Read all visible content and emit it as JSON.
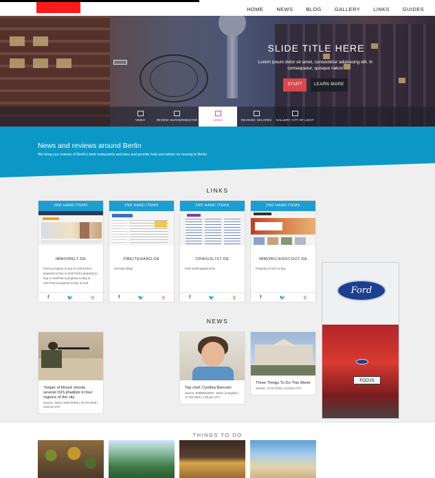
{
  "nav": {
    "items": [
      "HOME",
      "NEWS",
      "BLOG",
      "GALLERY",
      "LINKS",
      "GUIDES"
    ]
  },
  "slider": {
    "title": "SLIDE TITLE HERE",
    "subtitle": "Lorem ipsum dolor sit amet, consectetur adipisicing elit. In consequatur, quisque natus!",
    "start_label": "START",
    "more_label": "LEARN MORE",
    "tabs": [
      {
        "label": "VIDEO",
        "icon": "image-icon",
        "active": false
      },
      {
        "label": "REVIEW: BURGERMEISTER",
        "icon": "checkbox-icon",
        "active": false
      },
      {
        "label": "LINKS",
        "icon": "square-icon",
        "active": true
      },
      {
        "label": "REVIEWS: DELORES",
        "icon": "square-icon",
        "active": false
      },
      {
        "label": "GALLERY: CITY OF LIGHT",
        "icon": "square-icon",
        "active": false
      }
    ]
  },
  "intro": {
    "title": "News and reviews around Berlin",
    "subtitle": "We bring you reviews of Berlin's best restaurants and bars and provide help and advice on moving to Berlin"
  },
  "links": {
    "heading": "LINKS",
    "cards": [
      {
        "tag": "2ND HAND ITEMS",
        "site": "IMMOWELT.DE",
        "desc": "Find a property to buy or rent.Find a property to buy or rent.Find a property to buy or rentFind a property to buy or rent.Find a property to buy or rent."
      },
      {
        "tag": "2ND HAND ITEMS",
        "site": "ZWEITEHAND.DE",
        "desc": "German Ebay"
      },
      {
        "tag": "2ND HAND ITEMS",
        "site": "CRAIGSLIST.DE",
        "desc": "Find rental apartments"
      },
      {
        "tag": "2ND HAND ITEMS",
        "site": "IMMOBILIENSCOUT.DE",
        "desc": "Property to rent or buy"
      }
    ],
    "social": {
      "facebook": "f",
      "twitter": "🐦",
      "google": "g"
    }
  },
  "news": {
    "heading": "NEWS",
    "items": [
      {
        "title": "'Sniper of Mosul' shoots several ISIS jihadists in four regions of the city",
        "meta": "Source: Home | Mail Online | 20 Oct 2016 | 2:53 pm UTC"
      },
      {
        "title": "Top chef: Cynthia Barcomi",
        "meta": "Source: EXBERLINER - Berlin in English | 17 Oct 2016 | 1:53 pm UTC"
      },
      {
        "title": "Three Things To Do This Week",
        "meta": "Source: | 4 Oct 2016 | 4:20 pm UTC"
      }
    ]
  },
  "ad": {
    "brand": "Ford",
    "plate": "FOCUS"
  },
  "things": {
    "heading": "THINGS TO DO"
  },
  "colors": {
    "accent": "#0b98c6",
    "card_header": "#1d9dd0",
    "start": "#d9474f",
    "active_tab": "#d13ad6"
  }
}
